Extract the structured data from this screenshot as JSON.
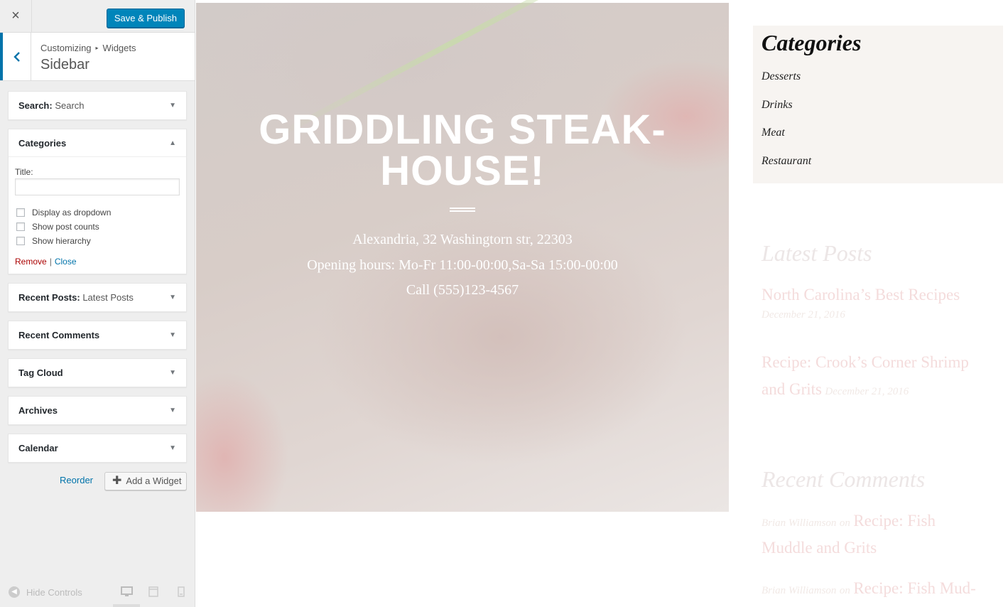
{
  "topbar": {
    "close_icon": "×",
    "publish_label": "Save & Publish"
  },
  "section": {
    "breadcrumb_root": "Customizing",
    "breadcrumb_sep": "▸",
    "breadcrumb_leaf": "Widgets",
    "title": "Sidebar"
  },
  "widgets": {
    "search": {
      "label": "Search:",
      "sub": "Search"
    },
    "categories": {
      "label": "Categories",
      "title_label": "Title:",
      "title_value": "",
      "opt_dropdown": "Display as dropdown",
      "opt_counts": "Show post counts",
      "opt_hierarchy": "Show hierarchy",
      "remove": "Remove",
      "pipe": "|",
      "close": "Close"
    },
    "recent_posts": {
      "label": "Recent Posts:",
      "sub": "Latest Posts"
    },
    "recent_comments": {
      "label": "Recent Comments"
    },
    "tag_cloud": {
      "label": "Tag Cloud"
    },
    "archives": {
      "label": "Archives"
    },
    "calendar": {
      "label": "Calendar"
    }
  },
  "actions": {
    "reorder": "Reorder",
    "add_widget": "Add a Widget"
  },
  "footer": {
    "hide_controls": "Hide Controls"
  },
  "hero": {
    "title_line1": "GRIDDLING STEAK-",
    "title_line2": "HOUSE!",
    "address": "Alexandria, 32 Washingtorn str, 22303",
    "hours": "Opening hours: Mo-Fr 11:00-00:00,Sa-Sa 15:00-00:00",
    "phone": "Call (555)123-4567"
  },
  "sidebar_preview": {
    "categories_title": "Categories",
    "categories": [
      "Desserts",
      "Drinks",
      "Meat",
      "Restaurant"
    ],
    "latest_posts_title": "Latest Posts",
    "posts": [
      {
        "title": "North Carolina’s Best Recipes",
        "date": "December 21, 2016"
      },
      {
        "title": "Recipe: Crook’s Corner Shrimp and Grits",
        "date": "December 21, 2016"
      }
    ],
    "recent_comments_title": "Recent Comments",
    "comments": [
      {
        "author": "Brian Williamson",
        "on": "on",
        "post": "Recipe: Fish Muddle and Grits"
      },
      {
        "author": "Brian Williamson",
        "on": "on",
        "post": "Recipe: Fish Mud-"
      }
    ]
  },
  "colors": {
    "primary_button": "#0085ba",
    "link_blue": "#0073aa",
    "remove_red": "#aa0000"
  }
}
